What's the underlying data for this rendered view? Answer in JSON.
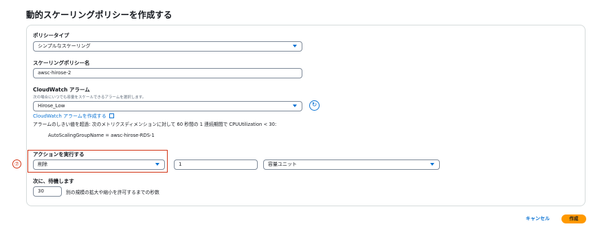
{
  "page": {
    "title": "動的スケーリングポリシーを作成する"
  },
  "policy_type": {
    "label": "ポリシータイプ",
    "value": "シンプルなスケーリング"
  },
  "policy_name": {
    "label": "スケーリングポリシー名",
    "value": "awsc-hirose-2"
  },
  "alarm": {
    "label": "CloudWatch アラーム",
    "description": "次の場合にいつでも容量をスケールできるアラームを選択します。",
    "value": "Hirose_Low",
    "create_link": "CloudWatch アラームを作成する",
    "threshold_text": "アラームのしきい値を超過: 次のメトリクスディメンションに対して 60 秒間の 1 連続期間で CPUUtilization < 30:",
    "dimension_text": "AutoScalingGroupName = awsc-hirose-RDS-1"
  },
  "action": {
    "label": "アクションを実行する",
    "operation": "削除",
    "amount": "1",
    "unit": "容量ユニット"
  },
  "annotation": {
    "marker": "⑦"
  },
  "wait": {
    "label": "次に、待機します",
    "value": "30",
    "suffix": "別の規模の拡大や縮小を許可するまでの秒数"
  },
  "footer": {
    "cancel_label": "キャンセル",
    "create_label": "作成"
  },
  "colors": {
    "accent": "#0972d3",
    "primary_button": "#ff9900",
    "highlight": "#d13212"
  },
  "icons": {
    "dropdown": "chevron-down-icon",
    "external": "external-link-icon",
    "refresh": "refresh-icon"
  }
}
